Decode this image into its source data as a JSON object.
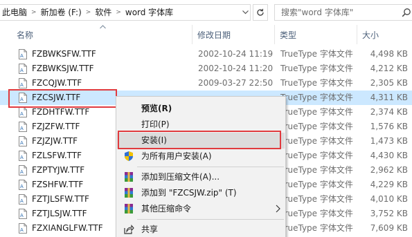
{
  "address": {
    "breadcrumbs": [
      "此电脑",
      "新加卷 (F:)",
      "软件",
      "word 字体库"
    ],
    "search_placeholder": "搜索\"word 字体库\""
  },
  "columns": {
    "name": "名称",
    "date": "修改日期",
    "type": "类型",
    "size": "大小"
  },
  "files": [
    {
      "name": "FZBWKSFW.TTF",
      "date": "2002-10-24 11:19",
      "type": "TrueType 字体文件",
      "size": "4,498 KB"
    },
    {
      "name": "FZBWKSJW.TTF",
      "date": "2002-10-24 11:20",
      "type": "TrueType 字体文件",
      "size": "4,212 KB"
    },
    {
      "name": "FZCQJW.TTF",
      "date": "2009-03-27 22:50",
      "type": "TrueType 字体文件",
      "size": "2,305 KB"
    },
    {
      "name": "FZCSJW.TTF",
      "date": "",
      "type": "TrueType 字体文件",
      "size": "4,311 KB"
    },
    {
      "name": "FZDHTFW.TTF",
      "date": "",
      "type": "TrueType 字体文件",
      "size": "2,374 KB"
    },
    {
      "name": "FZJZFW.TTF",
      "date": "",
      "type": "TrueType 字体文件",
      "size": "1,576 KB"
    },
    {
      "name": "FZJZJW.TTF",
      "date": "",
      "type": "TrueType 字体文件",
      "size": "1,473 KB"
    },
    {
      "name": "FZLSFW.TTF",
      "date": "",
      "type": "TrueType 字体文件",
      "size": "4,430 KB"
    },
    {
      "name": "FZPTYJW.TTF",
      "date": "",
      "type": "TrueType 字体文件",
      "size": "2,962 KB"
    },
    {
      "name": "FZSHFW.TTF",
      "date": "",
      "type": "TrueType 字体文件",
      "size": "4,229 KB"
    },
    {
      "name": "FZTJLSFW.TTF",
      "date": "",
      "type": "TrueType 字体文件",
      "size": "4,010 KB"
    },
    {
      "name": "FZTJLSJW.TTF",
      "date": "",
      "type": "TrueType 字体文件",
      "size": "3,752 KB"
    },
    {
      "name": "FZXIANGLFW.TTF",
      "date": "",
      "type": "TrueType 字体文件",
      "size": "7,609 KB"
    }
  ],
  "context_menu": {
    "preview": "预览(R)",
    "print": "打印(P)",
    "install": "安装(I)",
    "install_all_users": "为所有用户安装(A)",
    "add_to_archive": "添加到压缩文件(A)...",
    "add_to_zip": "添加到 \"FZCSJW.zip\" (T)",
    "other_compress": "其他压缩命令",
    "share": "共享"
  }
}
